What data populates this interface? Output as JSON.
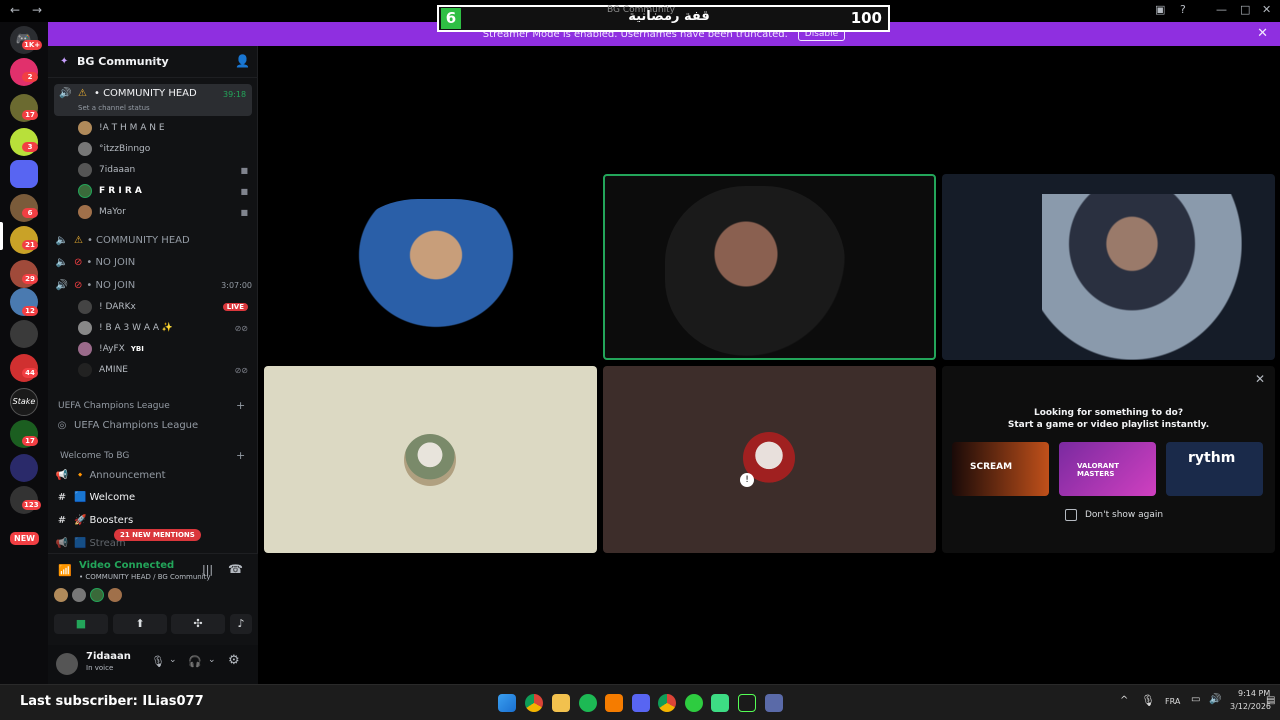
{
  "titlebar": {
    "title": "BG Community"
  },
  "overlay": {
    "left_number": "6",
    "center_text": "قفة رمضانية",
    "right_number": "100"
  },
  "streamer_banner": {
    "text": "Streamer Mode is enabled. Usernames have been truncated.",
    "disable_label": "Disable",
    "close_label": "✕"
  },
  "guild_badges": [
    "1K+",
    "2",
    "17",
    "3",
    "6",
    "21",
    "29",
    "12",
    "44",
    "17",
    "123",
    "NEW"
  ],
  "server": {
    "name": "BG Community"
  },
  "channels": {
    "active_voice": {
      "name": "• COMMUNITY HEAD",
      "timer": "39:18",
      "status_hint": "Set a channel status"
    },
    "active_users": [
      {
        "name": "!A T H M A N E",
        "color": "#b5bac1"
      },
      {
        "name": "°itzzBinngo",
        "color": "#b5bac1"
      },
      {
        "name": "7idaaan",
        "color": "#b5bac1"
      },
      {
        "name": "F R I R A",
        "color": "#ffffff"
      },
      {
        "name": "MaYor",
        "color": "#b5bac1"
      }
    ],
    "voice2": {
      "name": "• COMMUNITY HEAD"
    },
    "nojoin1": {
      "name": "• NO JOIN"
    },
    "nojoin2": {
      "name": "• NO JOIN",
      "timer": "3:07:00"
    },
    "nojoin_users": [
      {
        "name": "! DARKx",
        "badge": "LIVE"
      },
      {
        "name": "! B A 3 W A A ✨"
      },
      {
        "name": "!AyFX",
        "badge": "YBI"
      },
      {
        "name": "AMINE"
      }
    ],
    "category1": "UEFA Champions League",
    "category1_channel": "UEFA Champions League",
    "category2": "Welcome To BG",
    "text_channels": [
      {
        "name": "Announcement"
      },
      {
        "name": "Welcome"
      },
      {
        "name": "Boosters"
      },
      {
        "name": "Stream"
      }
    ],
    "mentions_badge": "21 NEW MENTIONS"
  },
  "voice_panel": {
    "status": "Video Connected",
    "location": "• COMMUNITY HEAD / BG Community"
  },
  "user_panel": {
    "username": "7idaaan",
    "status": "In voice"
  },
  "stage": {
    "activity_title": "Looking for something to do?",
    "activity_sub": "Start a game or video playlist instantly.",
    "activities": [
      "SCREAM",
      "VALORANT MASTERS",
      "rythm"
    ],
    "dont_show": "Don't show again"
  },
  "taskbar": {
    "ticker": "Last subscriber: ILias077",
    "lang": "FRA",
    "time": "9:14 PM",
    "date": "3/12/2026"
  },
  "colors": {
    "accent_purple": "#8f2fe0",
    "green": "#23a55a",
    "live_red": "#da373c"
  }
}
